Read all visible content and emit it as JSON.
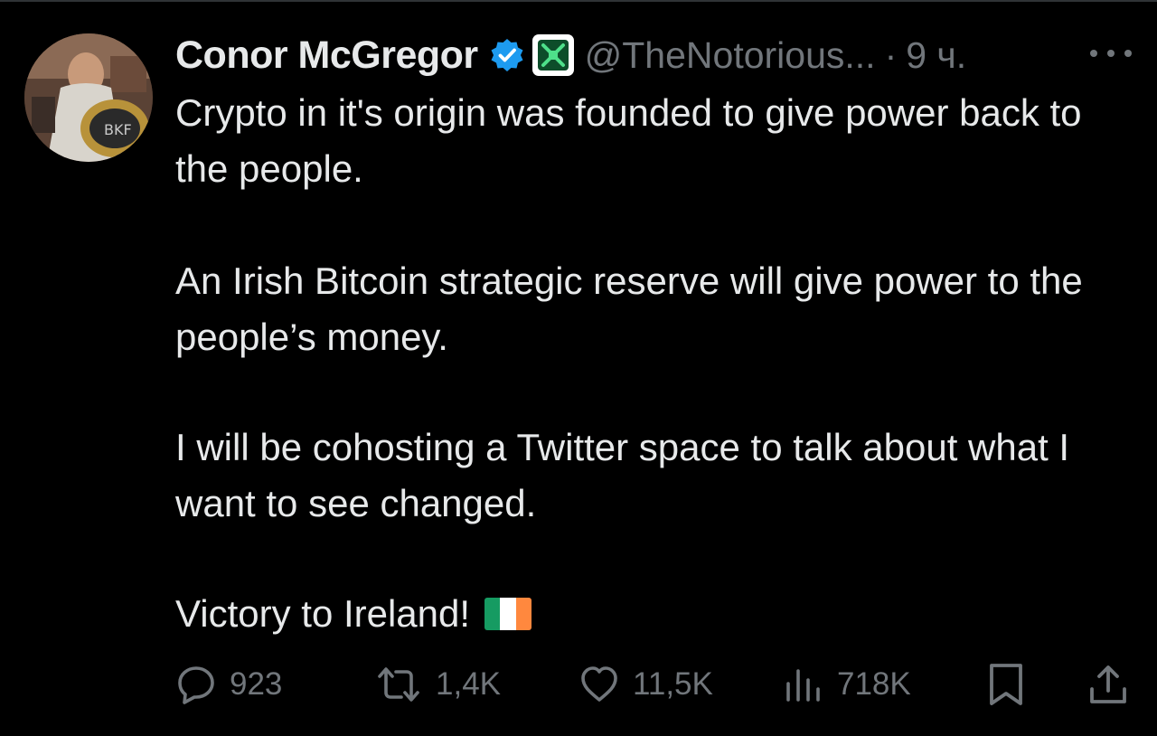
{
  "tweet": {
    "author_name": "Conor McGregor",
    "handle": "@TheNotorious...",
    "separator": "·",
    "time": "9 ч.",
    "paragraphs": [
      "Crypto in it's origin was founded to give power back to the people.",
      "An Irish Bitcoin strategic reserve will give power to the people’s money.",
      "I will be cohosting a Twitter space to talk about what I want to see changed.",
      "Victory to Ireland!"
    ],
    "icons": {
      "verified": "verified-badge-icon",
      "affiliate": "affiliate-badge-icon",
      "more": "more-icon",
      "flag": "ireland-flag-icon"
    },
    "colors": {
      "background": "#000000",
      "text": "#e7e9ea",
      "muted": "#71767b",
      "verified": "#1d9bf0"
    }
  },
  "actions": {
    "reply_count": "923",
    "retweet_count": "1,4K",
    "like_count": "11,5K",
    "views_count": "718K",
    "icons": [
      "reply-icon",
      "retweet-icon",
      "like-icon",
      "views-icon",
      "bookmark-icon",
      "share-icon"
    ]
  }
}
